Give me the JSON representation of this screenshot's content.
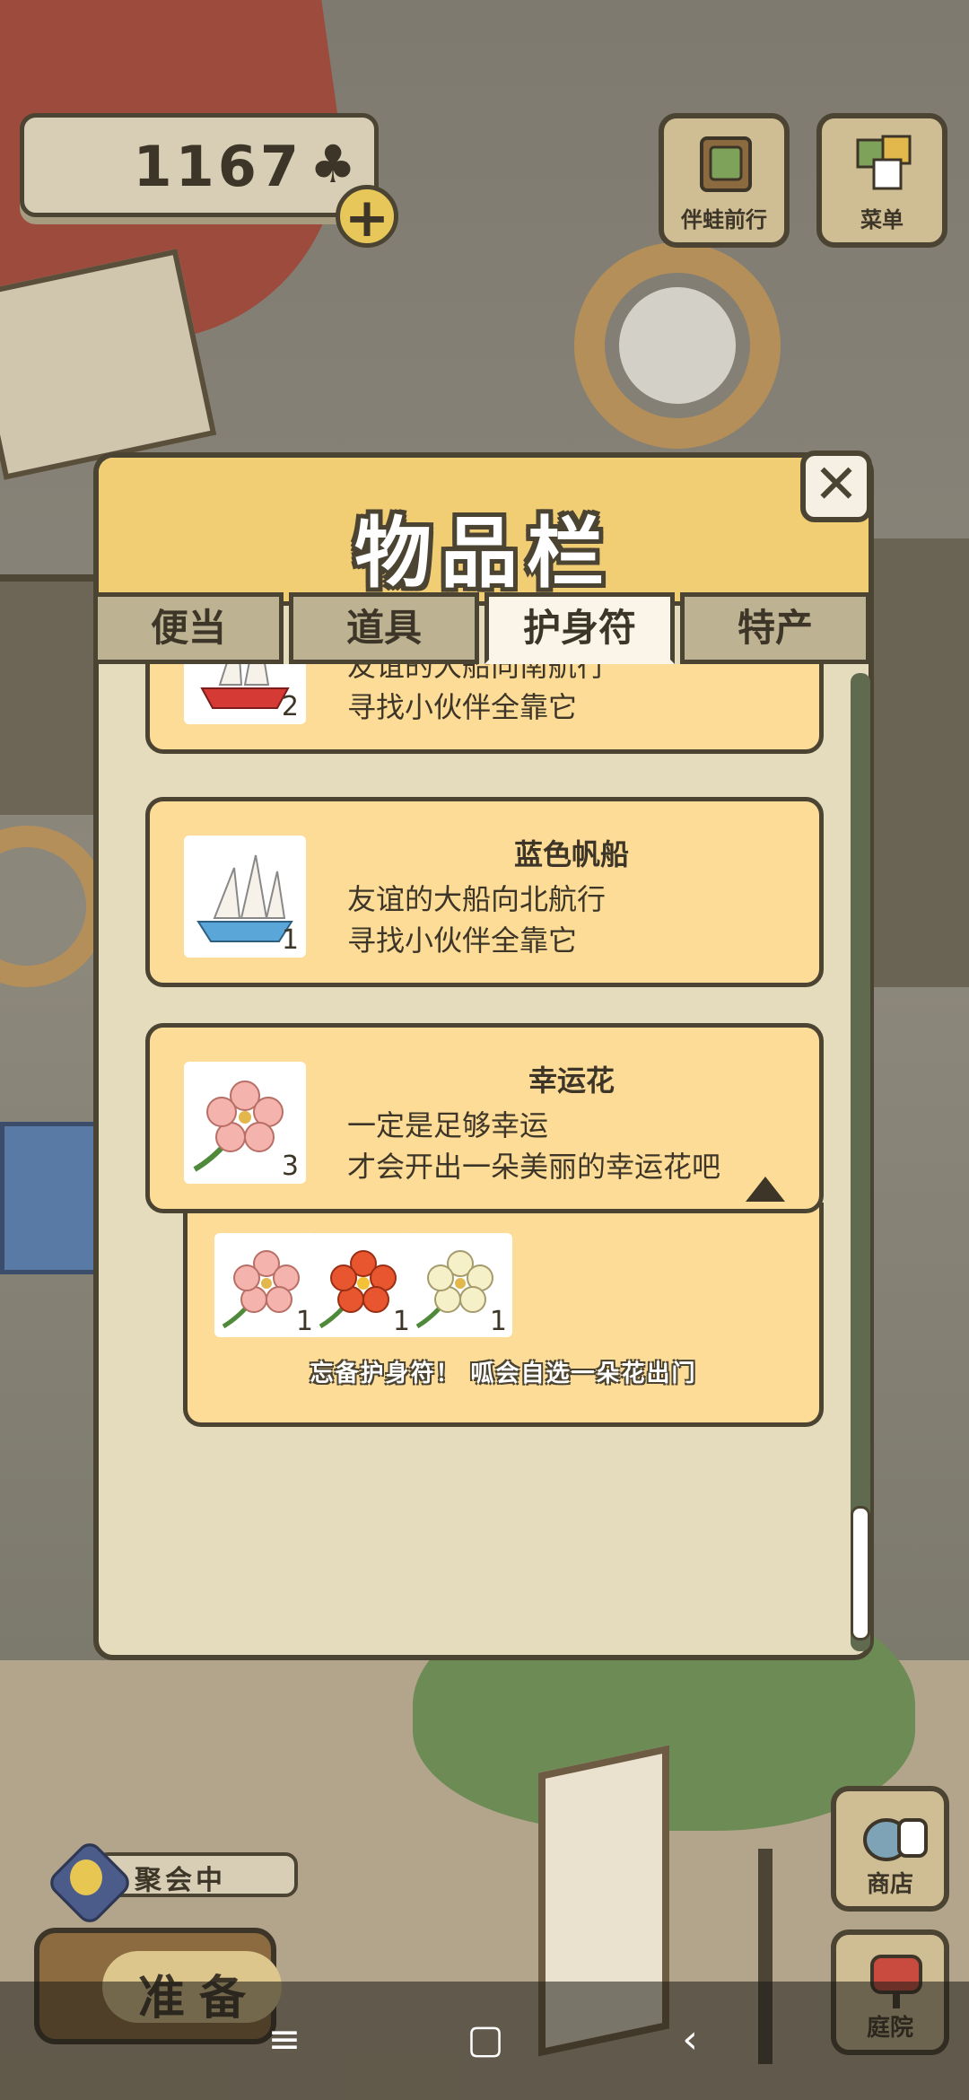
{
  "hud": {
    "clover_count": "1167",
    "clover_icon": "clover-icon",
    "add_icon": "plus-icon",
    "travel_companion_label": "伴蛙前行",
    "menu_label": "菜单",
    "shop_label": "商店",
    "garden_label": "庭院",
    "party_label": "聚会中",
    "ready_label": "准备"
  },
  "modal": {
    "title": "物品栏",
    "close_icon": "close-icon",
    "tabs": [
      {
        "label": "便当",
        "active": false
      },
      {
        "label": "道具",
        "active": false
      },
      {
        "label": "护身符",
        "active": true
      },
      {
        "label": "特产",
        "active": false
      }
    ],
    "items": [
      {
        "name": "",
        "line1": "友谊的大船向南航行",
        "line2": "寻找小伙伴全靠它",
        "count": "2",
        "icon": "red-sailboat-icon"
      },
      {
        "name": "蓝色帆船",
        "line1": "友谊的大船向北航行",
        "line2": "寻找小伙伴全靠它",
        "count": "1",
        "icon": "blue-sailboat-icon"
      },
      {
        "name": "幸运花",
        "line1": "一定是足够幸运",
        "line2": "才会开出一朵美丽的幸运花吧",
        "count": "3",
        "icon": "lucky-flower-icon"
      }
    ],
    "flower_variants": [
      {
        "count": "1",
        "color": "#f4b3ad",
        "icon": "pink-flower-icon"
      },
      {
        "count": "1",
        "color": "#e8562f",
        "icon": "red-flower-icon"
      },
      {
        "count": "1",
        "color": "#f6f0c8",
        "icon": "white-flower-icon"
      }
    ],
    "flower_note": "忘备护身符！ 呱会自选一朵花出门"
  },
  "navbar": {
    "menu_icon": "menu-lines-icon",
    "home_icon": "square-home-icon",
    "back_icon": "back-chevron-icon"
  },
  "colors": {
    "accent": "#f1cd74",
    "card": "#fddc97",
    "outline": "#4c4432"
  }
}
